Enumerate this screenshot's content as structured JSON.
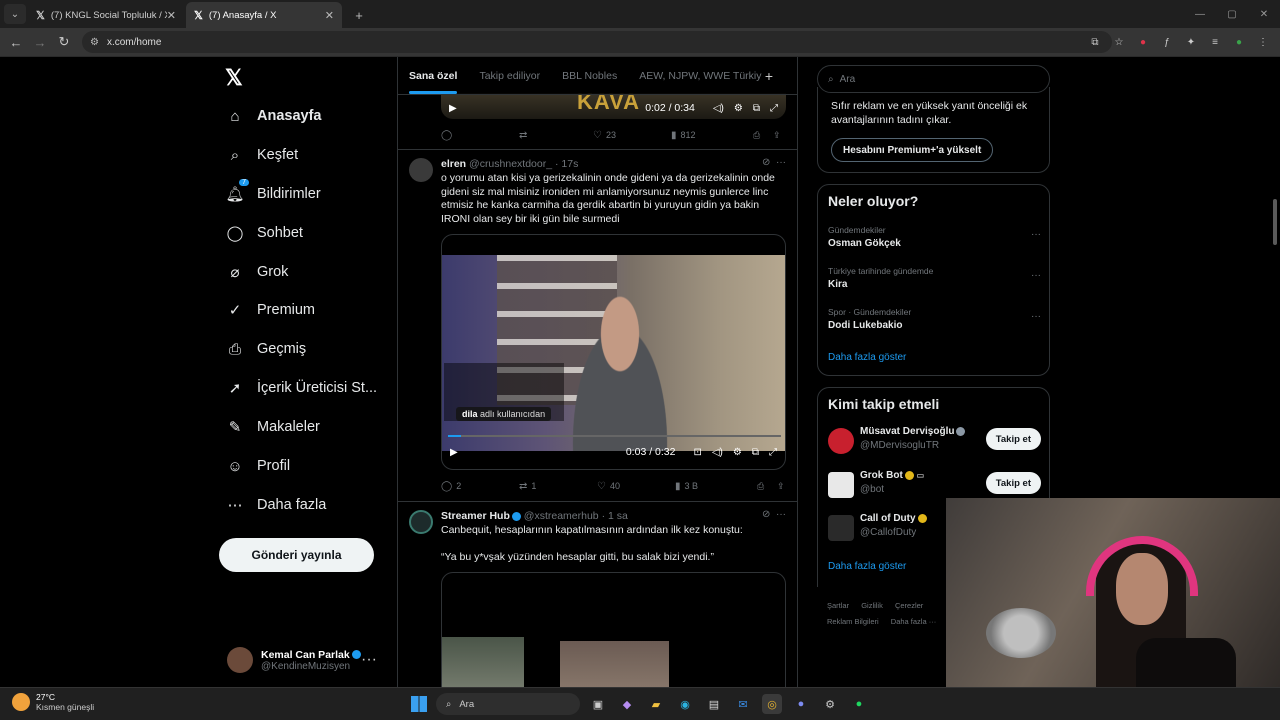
{
  "browser": {
    "tabs": [
      {
        "title": "(7) KNGL Social Topluluk / X",
        "active": false
      },
      {
        "title": "(7) Anasayfa / X",
        "active": true
      }
    ],
    "url": "x.com/home"
  },
  "nav": {
    "items": [
      {
        "label": "Anasayfa",
        "icon": "home-icon",
        "bold": true
      },
      {
        "label": "Keşfet",
        "icon": "search-icon"
      },
      {
        "label": "Bildirimler",
        "icon": "bell-icon",
        "badge": "7"
      },
      {
        "label": "Sohbet",
        "icon": "chat-icon"
      },
      {
        "label": "Grok",
        "icon": "grok-icon"
      },
      {
        "label": "Premium",
        "icon": "premium-icon"
      },
      {
        "label": "Geçmiş",
        "icon": "bookmark-icon"
      },
      {
        "label": "İçerik Üreticisi St...",
        "icon": "rocket-icon"
      },
      {
        "label": "Makaleler",
        "icon": "article-icon"
      },
      {
        "label": "Profil",
        "icon": "profile-icon"
      },
      {
        "label": "Daha fazla",
        "icon": "more-icon"
      }
    ],
    "post_button": "Gönderi yayınla",
    "account": {
      "name": "Kemal Can Parlak",
      "handle": "@KendineMuzisyen"
    }
  },
  "feed": {
    "tabs": [
      "Sana özel",
      "Takip ediliyor",
      "BBL Nobles",
      "AEW, NJPW, WWE Türkiy"
    ],
    "video_top": {
      "label": "KAVA",
      "time": "0:02 / 0:34"
    },
    "actions_top": {
      "reply": "",
      "retweet": "",
      "like": "23",
      "views": "812"
    },
    "tweet1": {
      "name": "elren",
      "handle": "@crushnextdoor_",
      "time": "17s",
      "text": "o yorumu atan kisi ya gerizekalinin onde gideni ya da gerizekalinin onde gideni siz mal misiniz ironiden mi anlamiyorsunuz neymis gunlerce linc etmisiz he kanka carmiha da gerdik abartin bi yuruyun gidin ya bakin IRONI olan sey bir iki gün bile surmedi",
      "video_time": "0:03 / 0:32",
      "video_progress": 0.04,
      "overlay_user": "dila",
      "overlay_text": "adlı kullanıcıdan",
      "actions": {
        "reply": "2",
        "retweet": "1",
        "like": "40",
        "views": "3 B"
      }
    },
    "tweet2": {
      "name": "Streamer Hub",
      "handle": "@xstreamerhub",
      "time": "1 sa",
      "line1": "Canbequit, hesaplarının kapatılmasının ardından ilk kez konuştu:",
      "line2": "“Ya bu y*vşak yüzünden hesaplar gitti, bu salak bizi yendi.”"
    }
  },
  "right": {
    "search_placeholder": "Ara",
    "premium": {
      "text": "Sıfır reklam ve en yüksek yanıt önceliği ek avantajlarının tadını çıkar.",
      "button": "Hesabını Premium+'a yükselt"
    },
    "trends": {
      "title": "Neler oluyor?",
      "items": [
        {
          "context": "Gündemdekiler",
          "name": "Osman Gökçek"
        },
        {
          "context": "Türkiye tarihinde gündemde",
          "name": "Kira"
        },
        {
          "context": "Spor · Gündemdekiler",
          "name": "Dodi Lukebakio"
        }
      ],
      "more": "Daha fazla göster"
    },
    "follow": {
      "title": "Kimi takip etmeli",
      "items": [
        {
          "name": "Müsavat Dervişoğlu",
          "handle": "@MDervisogluTR",
          "button": "Takip et"
        },
        {
          "name": "Grok Bot",
          "handle": "@bot",
          "button": "Takip et"
        },
        {
          "name": "Call of Duty",
          "handle": "@CallofDuty"
        }
      ],
      "more": "Daha fazla göster"
    },
    "footer": [
      "Şartlar",
      "Gizlilik",
      "Çerezler",
      "Reklam Bilgileri",
      "Daha fazla ···"
    ]
  },
  "taskbar": {
    "temp": "27°C",
    "condition": "Kısmen güneşli",
    "search": "Ara"
  }
}
